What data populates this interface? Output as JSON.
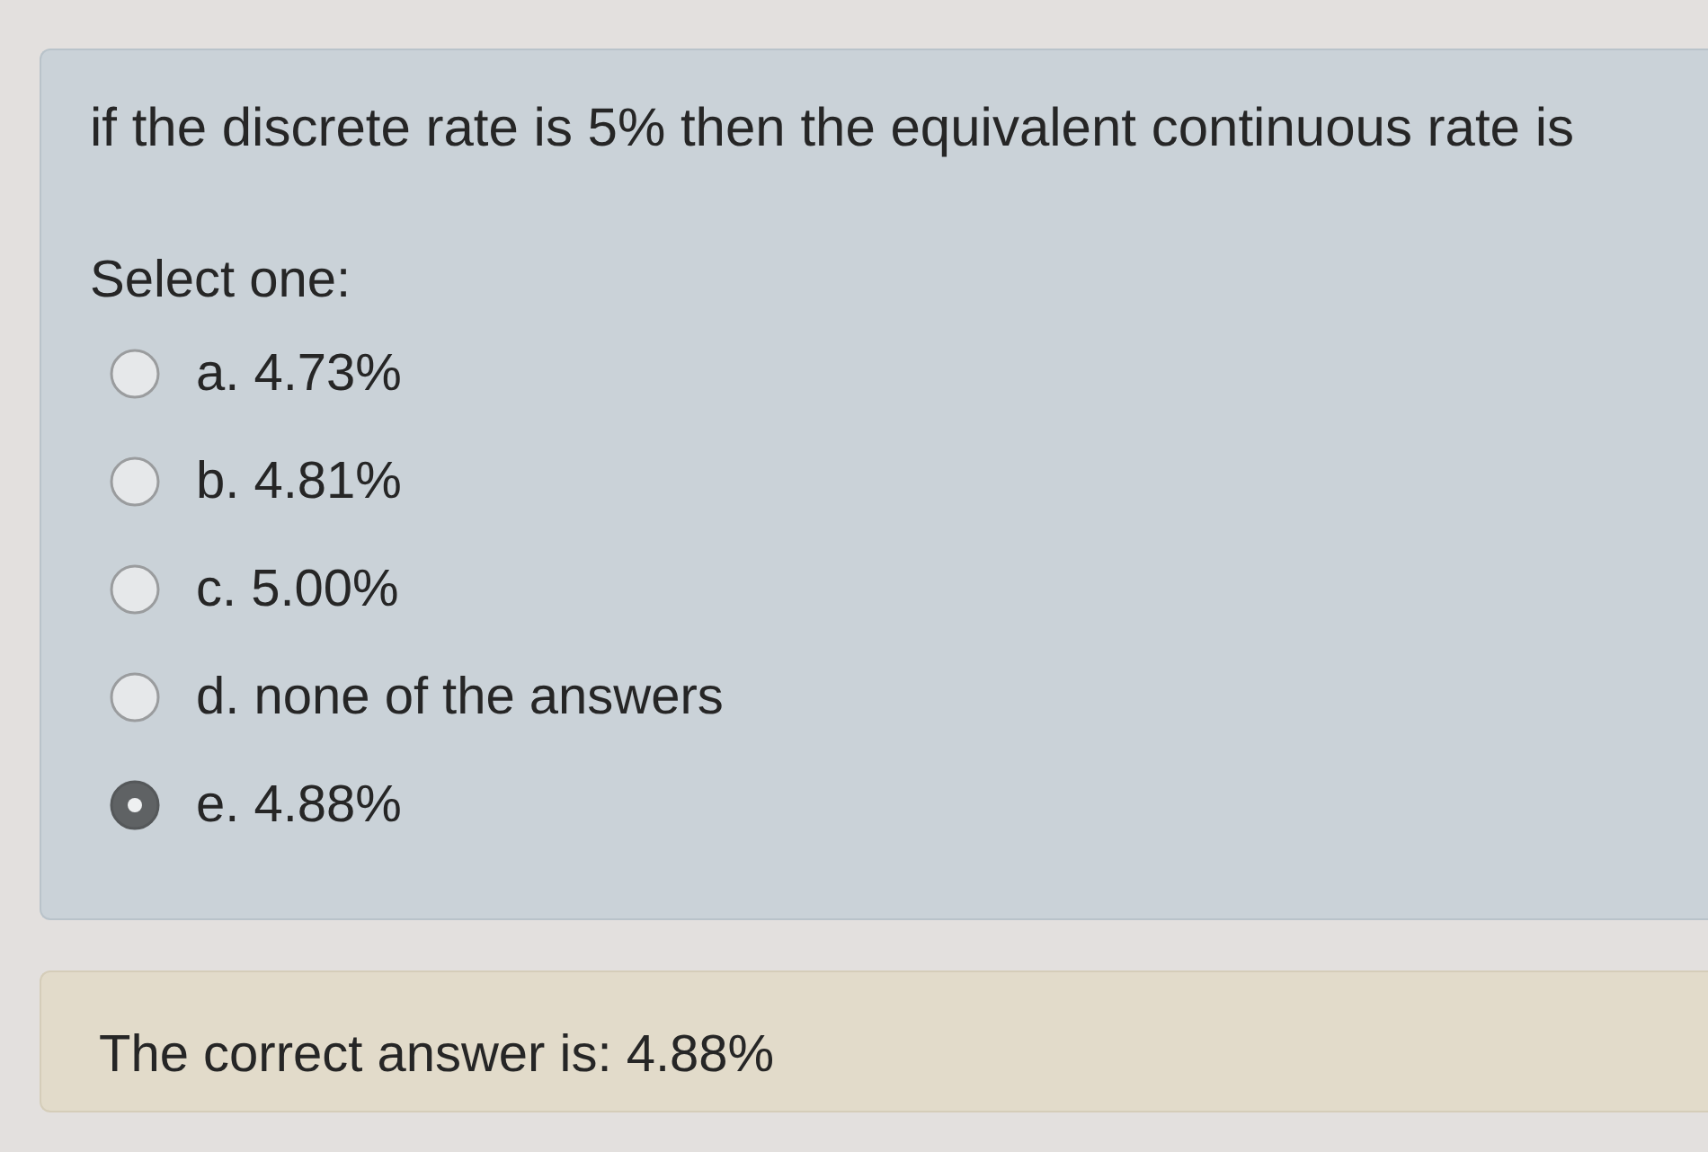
{
  "question": {
    "text": "if the discrete rate is 5% then the equivalent continuous rate is",
    "prompt": "Select one:",
    "options": [
      {
        "label": "a. 4.73%",
        "selected": false
      },
      {
        "label": "b. 4.81%",
        "selected": false
      },
      {
        "label": "c. 5.00%",
        "selected": false
      },
      {
        "label": "d. none of the answers",
        "selected": false
      },
      {
        "label": "e. 4.88%",
        "selected": true
      }
    ]
  },
  "feedback": {
    "text": "The correct answer is: 4.88%"
  }
}
